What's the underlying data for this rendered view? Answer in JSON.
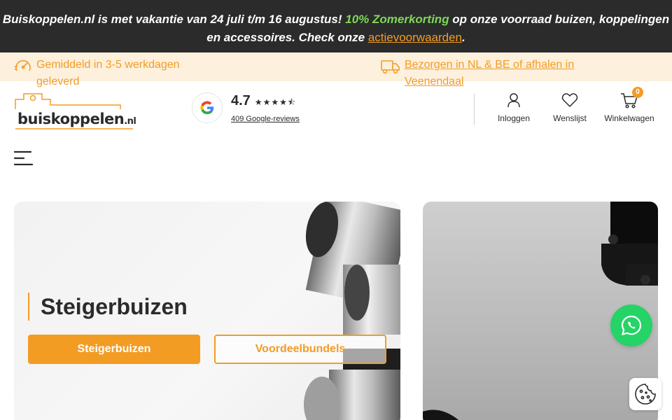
{
  "promo": {
    "text_before": "Buiskoppelen.nl is met vakantie van 24 juli t/m 16 augustus! ",
    "highlight": "10% Zomerkorting",
    "text_middle": " op onze voorraad buizen, koppelingen en accessoires. Check onze ",
    "link": "actievoorwaarden",
    "text_after": "."
  },
  "usp": {
    "delivery": "Gemiddeld in 3-5 werkdagen geleverd",
    "shipping": "Bezorgen in NL & BE of afhalen in Veenendaal"
  },
  "logo": {
    "main": "buiskoppelen",
    "suffix": ".nl"
  },
  "reviews": {
    "score": "4.7",
    "stars": "★★★★⯪",
    "count_label": "409 Google-reviews"
  },
  "nav": {
    "login": "Inloggen",
    "wishlist": "Wenslijst",
    "cart": "Winkelwagen",
    "cart_count": "0"
  },
  "hero": {
    "title": "Steigerbuizen",
    "primary_button": "Steigerbuizen",
    "secondary_button": "Voordeelbundels"
  },
  "colors": {
    "accent": "#f39c24",
    "promo_bg": "#2b2b2b",
    "promo_highlight": "#7ed957",
    "usp_bg": "#fdf0dc",
    "whatsapp": "#25d366"
  },
  "icons": [
    "speedometer-icon",
    "truck-icon",
    "google-icon",
    "user-icon",
    "heart-icon",
    "cart-icon",
    "hamburger-menu-icon",
    "whatsapp-icon",
    "cookie-icon"
  ]
}
